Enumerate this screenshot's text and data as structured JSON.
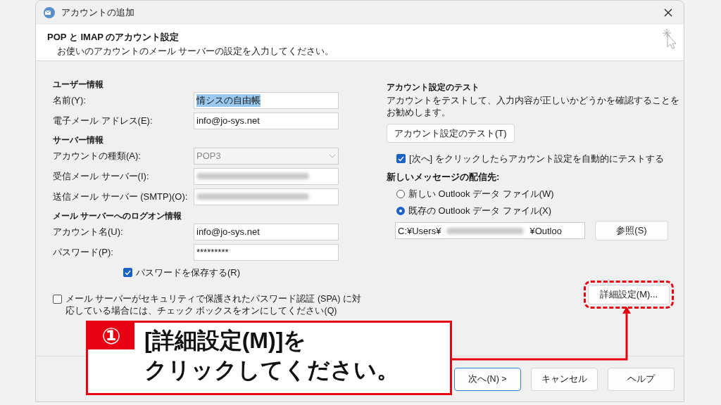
{
  "window": {
    "title": "アカウントの追加"
  },
  "header": {
    "title": "POP と IMAP のアカウント設定",
    "subtitle": "お使いのアカウントのメール サーバーの設定を入力してください。"
  },
  "left": {
    "sections": [
      {
        "heading": "ユーザー情報",
        "fields": [
          {
            "label": "名前(Y):",
            "kind": "text",
            "value": "情シスの自由帳",
            "highlighted": true
          },
          {
            "label": "電子メール アドレス(E):",
            "kind": "text",
            "value": "info@jo-sys.net",
            "highlighted": false
          }
        ]
      },
      {
        "heading": "サーバー情報",
        "fields": [
          {
            "label": "アカウントの種類(A):",
            "kind": "dropdown",
            "value": "POP3",
            "highlighted": false
          },
          {
            "label": "受信メール サーバー(I):",
            "kind": "redacted",
            "highlighted": false
          },
          {
            "label": "送信メール サーバー (SMTP)(O):",
            "kind": "redacted",
            "highlighted": false
          }
        ]
      },
      {
        "heading": "メール サーバーへのログオン情報",
        "fields": [
          {
            "label": "アカウント名(U):",
            "kind": "text",
            "value": "info@jo-sys.net",
            "highlighted": false
          },
          {
            "label": "パスワード(P):",
            "kind": "text",
            "value": "*********",
            "highlighted": false
          }
        ]
      }
    ],
    "save_password": {
      "label": "パスワードを保存する(R)",
      "checked": true
    },
    "spa": {
      "label": "メール サーバーがセキュリティで保護されたパスワード認証 (SPA) に対応している場合には、チェック ボックスをオンにしてください(Q)",
      "checked": false
    }
  },
  "right": {
    "test_heading": "アカウント設定のテスト",
    "test_text": "アカウントをテストして、入力内容が正しいかどうかを確認することをお勧めします。",
    "test_button": "アカウント設定のテスト(T)",
    "auto_test": {
      "label": "[次へ] をクリックしたらアカウント設定を自動的にテストする",
      "checked": true
    },
    "delivery_heading": "新しいメッセージの配信先:",
    "delivery_options": [
      {
        "label": "新しい Outlook データ ファイル(W)",
        "selected": false
      },
      {
        "label": "既存の Outlook データ ファイル(X)",
        "selected": true
      }
    ],
    "path": {
      "start": "C:¥Users¥",
      "end": "¥Outloo"
    },
    "browse_button": "参照(S)",
    "detail_button": "詳細設定(M)..."
  },
  "footer": {
    "buttons": [
      {
        "label": "次へ(N) >",
        "default": true
      },
      {
        "label": "キャンセル",
        "default": false
      },
      {
        "label": "ヘルプ",
        "default": false
      }
    ]
  },
  "callout": {
    "number": "①",
    "lines": [
      "[詳細設定(M)]を",
      "クリックしてください。"
    ]
  }
}
